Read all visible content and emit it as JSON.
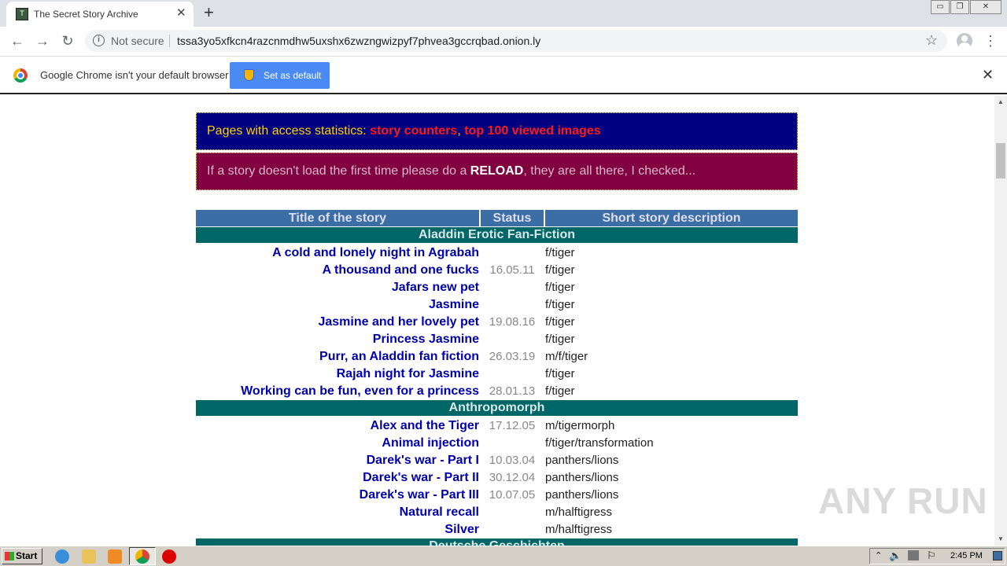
{
  "browser": {
    "tab_title": "The Secret Story Archive",
    "not_secure_label": "Not secure",
    "url": "tssa3yo5xfkcn4razcnmdhw5uxshx6zwzngwizpyf7phvea3gccrqbad.onion.ly",
    "infobar_text": "Google Chrome isn't your default browser",
    "set_default_label": "Set as default"
  },
  "notices": {
    "stats_prefix": "Pages with access statistics: ",
    "story_counters": "story counters",
    "comma": ", ",
    "top_images": "top 100 viewed images",
    "reload_prefix": "If a story doesn't load the first time please do a ",
    "reload_word": "RELOAD",
    "reload_suffix": ", they are all there, I checked..."
  },
  "table": {
    "headers": [
      "Title of the story",
      "Status",
      "Short story description"
    ],
    "categories": [
      {
        "name": "Aladdin Erotic Fan-Fiction",
        "stories": [
          {
            "title": "A cold and lonely night in Agrabah",
            "date": "",
            "desc": "f/tiger"
          },
          {
            "title": "A thousand and one fucks",
            "date": "16.05.11",
            "desc": "f/tiger"
          },
          {
            "title": "Jafars new pet",
            "date": "",
            "desc": "f/tiger"
          },
          {
            "title": "Jasmine",
            "date": "",
            "desc": "f/tiger"
          },
          {
            "title": "Jasmine and her lovely pet",
            "date": "19.08.16",
            "desc": "f/tiger"
          },
          {
            "title": "Princess Jasmine",
            "date": "",
            "desc": "f/tiger"
          },
          {
            "title": "Purr, an Aladdin fan fiction",
            "date": "26.03.19",
            "desc": "m/f/tiger"
          },
          {
            "title": "Rajah night for Jasmine",
            "date": "",
            "desc": "f/tiger"
          },
          {
            "title": "Working can be fun, even for a princess",
            "date": "28.01.13",
            "desc": "f/tiger"
          }
        ]
      },
      {
        "name": "Anthropomorph",
        "stories": [
          {
            "title": "Alex and the Tiger",
            "date": "17.12.05",
            "desc": "m/tigermorph"
          },
          {
            "title": "Animal injection",
            "date": "",
            "desc": "f/tiger/transformation"
          },
          {
            "title": "Darek's war - Part I",
            "date": "10.03.04",
            "desc": "panthers/lions"
          },
          {
            "title": "Darek's war - Part II",
            "date": "30.12.04",
            "desc": "panthers/lions"
          },
          {
            "title": "Darek's war - Part III",
            "date": "10.07.05",
            "desc": "panthers/lions"
          },
          {
            "title": "Natural recall",
            "date": "",
            "desc": "m/halftigress"
          },
          {
            "title": "Silver",
            "date": "",
            "desc": "m/halftigress"
          }
        ]
      },
      {
        "name": "Deutsche Geschichten",
        "stories": []
      }
    ]
  },
  "watermark": "ANY RUN",
  "taskbar": {
    "start_label": "Start",
    "clock": "2:45 PM"
  },
  "colors": {
    "notice_blue": "#000080",
    "notice_red": "#800040",
    "header_bg": "#3a6ea5",
    "category_bg": "#006666",
    "title_link": "#0000aa"
  }
}
